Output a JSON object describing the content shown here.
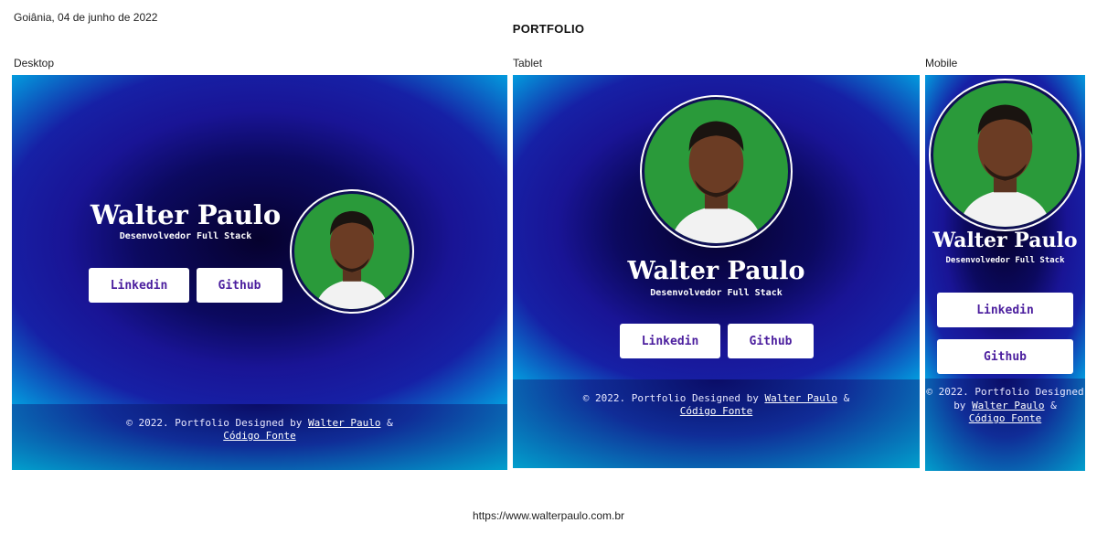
{
  "meta": {
    "date": "Goiânia, 04 de junho de 2022",
    "title": "PORTFOLIO",
    "url": "https://www.walterpaulo.com.br"
  },
  "devices": {
    "desktop": "Desktop",
    "tablet": "Tablet",
    "mobile": "Mobile"
  },
  "profile": {
    "name": "Walter Paulo",
    "role": "Desenvolvedor Full Stack",
    "avatar_icon": "profile-photo"
  },
  "buttons": {
    "linkedin": "Linkedin",
    "github": "Github"
  },
  "footer": {
    "prefix": "© 2022. Portfolio Designed by",
    "author_link": "Walter Paulo",
    "amp": "&",
    "source_link": "Código Fonte"
  },
  "colors": {
    "accent_text": "#4b1e9e",
    "avatar_bg": "#2a9a3a",
    "hero_dark": "#0a0850",
    "edge_cyan": "#00b4e6"
  }
}
